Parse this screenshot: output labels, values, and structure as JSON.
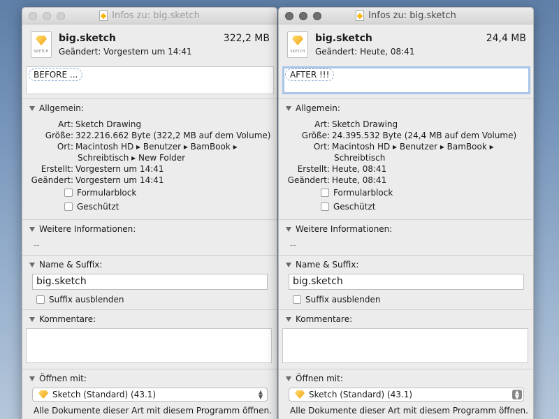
{
  "windows": [
    {
      "title": "Infos zu: big.sketch",
      "file": {
        "name": "big.sketch",
        "size": "322,2 MB",
        "modified": "Geändert: Vorgestern um 14:41",
        "icon_label": "SKETCH"
      },
      "tag": "BEFORE ...",
      "general": {
        "heading": "Allgemein:",
        "kind_label": "Art:",
        "kind": "Sketch Drawing",
        "size_label": "Größe:",
        "size": "322.216.662 Byte (322,2 MB auf dem Volume)",
        "where_label": "Ort:",
        "where_1": "Macintosh HD ▸ Benutzer ▸ BamBook ▸",
        "where_2": "Schreibtisch ▸ New Folder",
        "created_label": "Erstellt:",
        "created": "Vorgestern um 14:41",
        "modified_label": "Geändert:",
        "modified": "Vorgestern um 14:41",
        "stationery": "Formularblock",
        "locked": "Geschützt"
      },
      "more": {
        "heading": "Weitere Informationen:",
        "value": "--"
      },
      "name_ext": {
        "heading": "Name & Suffix:",
        "value": "big.sketch",
        "hide_ext": "Suffix ausblenden"
      },
      "comments": {
        "heading": "Kommentare:"
      },
      "open_with": {
        "heading": "Öffnen mit:",
        "app": "Sketch (Standard) (43.1)",
        "note": "Alle Dokumente dieser Art mit diesem Programm öffnen."
      }
    },
    {
      "title": "Infos zu: big.sketch",
      "file": {
        "name": "big.sketch",
        "size": "24,4 MB",
        "modified": "Geändert: Heute, 08:41",
        "icon_label": "SKETCH"
      },
      "tag": "AFTER !!!",
      "general": {
        "heading": "Allgemein:",
        "kind_label": "Art:",
        "kind": "Sketch Drawing",
        "size_label": "Größe:",
        "size": "24.395.532 Byte (24,4 MB auf dem Volume)",
        "where_label": "Ort:",
        "where_1": "Macintosh HD ▸ Benutzer ▸ BamBook ▸",
        "where_2": "Schreibtisch",
        "created_label": "Erstellt:",
        "created": "Heute, 08:41",
        "modified_label": "Geändert:",
        "modified": "Heute, 08:41",
        "stationery": "Formularblock",
        "locked": "Geschützt"
      },
      "more": {
        "heading": "Weitere Informationen:",
        "value": "--"
      },
      "name_ext": {
        "heading": "Name & Suffix:",
        "value": "big.sketch",
        "hide_ext": "Suffix ausblenden"
      },
      "comments": {
        "heading": "Kommentare:"
      },
      "open_with": {
        "heading": "Öffnen mit:",
        "app": "Sketch (Standard) (43.1)",
        "note": "Alle Dokumente dieser Art mit diesem Programm öffnen."
      }
    }
  ]
}
